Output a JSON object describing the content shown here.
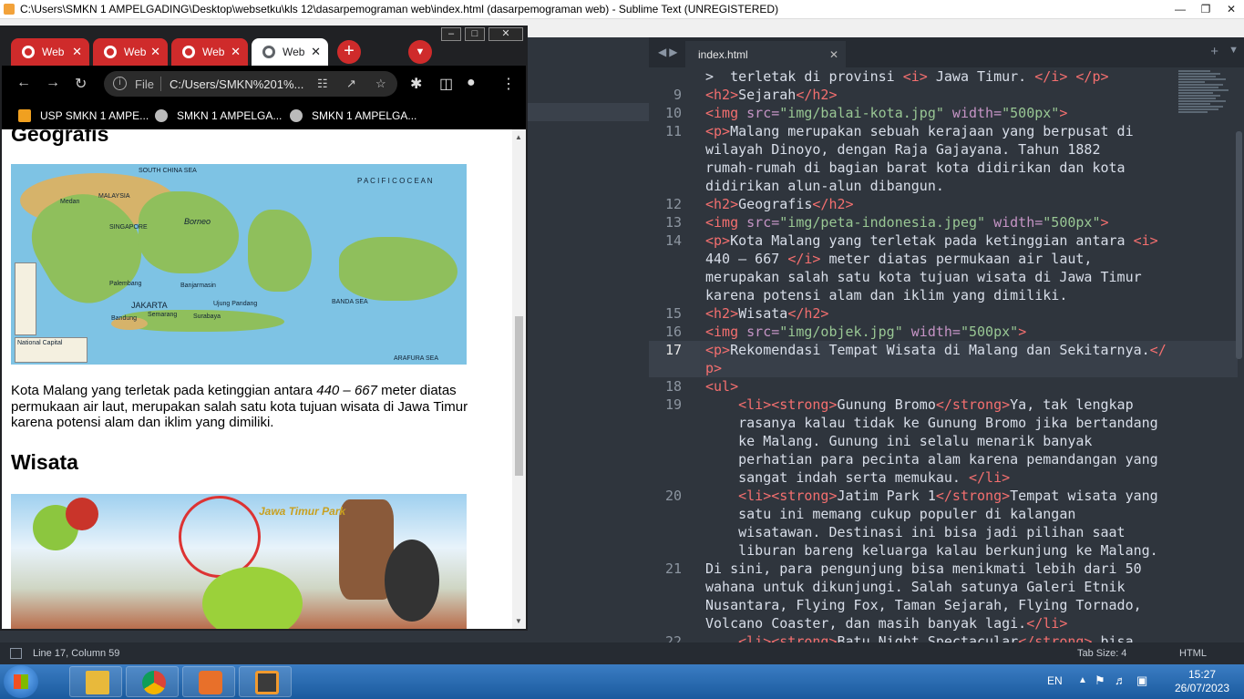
{
  "sublime": {
    "title": "C:\\Users\\SMKN 1 AMPELGADING\\Desktop\\websetku\\kls 12\\dasarpemograman web\\index.html (dasarpemograman web) - Sublime Text (UNREGISTERED)",
    "tab_label": "index.html",
    "status_position": "Line 17, Column 59",
    "status_tab_size": "Tab Size: 4",
    "status_syntax": "HTML"
  },
  "code_lines": [
    {
      "n": "",
      "parts": [
        [
          ">  terletak di provinsi ",
          "w"
        ],
        [
          "<i>",
          "t"
        ],
        [
          " Jawa Timur. ",
          "w"
        ],
        [
          "</i>",
          "t"
        ],
        [
          " ",
          "w"
        ],
        [
          "</p>",
          "t"
        ]
      ]
    },
    {
      "n": "9",
      "parts": [
        [
          "<h2>",
          "t"
        ],
        [
          "Sejarah",
          "w"
        ],
        [
          "</h2>",
          "t"
        ]
      ]
    },
    {
      "n": "10",
      "parts": [
        [
          "<img ",
          "t"
        ],
        [
          "src=",
          "a"
        ],
        [
          "\"img/balai-kota.jpg\"",
          "s"
        ],
        [
          " width=",
          "a"
        ],
        [
          "\"500px\"",
          "s"
        ],
        [
          ">",
          "t"
        ]
      ]
    },
    {
      "n": "11",
      "parts": [
        [
          "<p>",
          "t"
        ],
        [
          "Malang merupakan sebuah kerajaan yang berpusat di",
          "w"
        ]
      ]
    },
    {
      "n": "",
      "parts": [
        [
          "wilayah Dinoyo, dengan Raja Gajayana. Tahun 1882",
          "w"
        ]
      ]
    },
    {
      "n": "",
      "parts": [
        [
          "rumah-rumah di bagian barat kota didirikan dan kota",
          "w"
        ]
      ]
    },
    {
      "n": "",
      "parts": [
        [
          "didirikan alun-alun dibangun.",
          "w"
        ]
      ]
    },
    {
      "n": "12",
      "parts": [
        [
          "<h2>",
          "t"
        ],
        [
          "Geografis",
          "w"
        ],
        [
          "</h2>",
          "t"
        ]
      ]
    },
    {
      "n": "13",
      "parts": [
        [
          "<img ",
          "t"
        ],
        [
          "src=",
          "a"
        ],
        [
          "\"img/peta-indonesia.jpeg\"",
          "s"
        ],
        [
          " width=",
          "a"
        ],
        [
          "\"500px\"",
          "s"
        ],
        [
          ">",
          "t"
        ]
      ]
    },
    {
      "n": "14",
      "parts": [
        [
          "<p>",
          "t"
        ],
        [
          "Kota Malang yang terletak pada ketinggian antara ",
          "w"
        ],
        [
          "<i>",
          "t"
        ]
      ]
    },
    {
      "n": "",
      "parts": [
        [
          "440 – 667 ",
          "w"
        ],
        [
          "</i>",
          "t"
        ],
        [
          " meter diatas permukaan air laut,",
          "w"
        ]
      ]
    },
    {
      "n": "",
      "parts": [
        [
          "merupakan salah satu kota tujuan wisata di Jawa Timur",
          "w"
        ]
      ]
    },
    {
      "n": "",
      "parts": [
        [
          "karena potensi alam dan iklim yang dimiliki.",
          "w"
        ]
      ]
    },
    {
      "n": "15",
      "parts": [
        [
          "<h2>",
          "t"
        ],
        [
          "Wisata",
          "w"
        ],
        [
          "</h2>",
          "t"
        ]
      ]
    },
    {
      "n": "16",
      "parts": [
        [
          "<img ",
          "t"
        ],
        [
          "src=",
          "a"
        ],
        [
          "\"img/objek.jpg\"",
          "s"
        ],
        [
          " width=",
          "a"
        ],
        [
          "\"500px\"",
          "s"
        ],
        [
          ">",
          "t"
        ]
      ]
    },
    {
      "n": "17",
      "cur": true,
      "parts": [
        [
          "<p>",
          "t"
        ],
        [
          "Rekomendasi Tempat Wisata di Malang dan Sekitarnya.",
          "w"
        ],
        [
          "</",
          "t"
        ]
      ]
    },
    {
      "n": "",
      "cur": true,
      "parts": [
        [
          "p>",
          "t"
        ]
      ]
    },
    {
      "n": "18",
      "parts": [
        [
          "<ul>",
          "t"
        ]
      ]
    },
    {
      "n": "19",
      "parts": [
        [
          "    ",
          "w"
        ],
        [
          "<li>",
          "t"
        ],
        [
          "<strong>",
          "t"
        ],
        [
          "Gunung Bromo",
          "w"
        ],
        [
          "</strong>",
          "t"
        ],
        [
          "Ya, tak lengkap",
          "w"
        ]
      ]
    },
    {
      "n": "",
      "parts": [
        [
          "    rasanya kalau tidak ke Gunung Bromo jika bertandang",
          "w"
        ]
      ]
    },
    {
      "n": "",
      "parts": [
        [
          "    ke Malang. Gunung ini selalu menarik banyak",
          "w"
        ]
      ]
    },
    {
      "n": "",
      "parts": [
        [
          "    perhatian para pecinta alam karena pemandangan yang",
          "w"
        ]
      ]
    },
    {
      "n": "",
      "parts": [
        [
          "    sangat indah serta memukau. ",
          "w"
        ],
        [
          "</li>",
          "t"
        ]
      ]
    },
    {
      "n": "20",
      "parts": [
        [
          "    ",
          "w"
        ],
        [
          "<li>",
          "t"
        ],
        [
          "<strong>",
          "t"
        ],
        [
          "Jatim Park 1",
          "w"
        ],
        [
          "</strong>",
          "t"
        ],
        [
          "Tempat wisata yang",
          "w"
        ]
      ]
    },
    {
      "n": "",
      "parts": [
        [
          "    satu ini memang cukup populer di kalangan",
          "w"
        ]
      ]
    },
    {
      "n": "",
      "parts": [
        [
          "    wisatawan. Destinasi ini bisa jadi pilihan saat",
          "w"
        ]
      ]
    },
    {
      "n": "",
      "parts": [
        [
          "    liburan bareng keluarga kalau berkunjung ke Malang.",
          "w"
        ]
      ]
    },
    {
      "n": "21",
      "parts": [
        [
          "Di sini, para pengunjung bisa menikmati lebih dari 50",
          "w"
        ]
      ]
    },
    {
      "n": "",
      "parts": [
        [
          "wahana untuk dikunjungi. Salah satunya Galeri Etnik",
          "w"
        ]
      ]
    },
    {
      "n": "",
      "parts": [
        [
          "Nusantara, Flying Fox, Taman Sejarah, Flying Tornado,",
          "w"
        ]
      ]
    },
    {
      "n": "",
      "parts": [
        [
          "Volcano Coaster, dan masih banyak lagi.",
          "w"
        ],
        [
          "</li>",
          "t"
        ]
      ]
    },
    {
      "n": "22",
      "parts": [
        [
          "    ",
          "w"
        ],
        [
          "<li>",
          "t"
        ],
        [
          "<strong>",
          "t"
        ],
        [
          "Batu Night Spectacular",
          "w"
        ],
        [
          "</strong>",
          "t"
        ],
        [
          " bisa",
          "w"
        ]
      ]
    }
  ],
  "colors": {
    "tag": "#f46f6f",
    "attr": "#c594c5",
    "string": "#99c794",
    "text": "#d8dee9"
  },
  "chrome": {
    "tabs": [
      {
        "label": "Web",
        "active": false
      },
      {
        "label": "Web",
        "active": false
      },
      {
        "label": "Web",
        "active": false
      },
      {
        "label": "Web",
        "active": true
      }
    ],
    "address_file": "File",
    "address_url": "C:/Users/SMKN%201%...",
    "bookmarks": [
      "USP SMKN 1 AMPE...",
      "SMKN 1 AMPELGA...",
      "SMKN 1 AMPELGA..."
    ]
  },
  "webpage": {
    "heading_geografis": "Geografis",
    "map_labels": {
      "south_china_sea": "SOUTH CHINA SEA",
      "pacific_ocean": "P A C I F I C   O C E A N",
      "malaysia": "MALAYSIA",
      "medan": "Medan",
      "singapore": "SINGAPORE",
      "borneo": "Borneo",
      "palembang": "Palembang",
      "jakarta": "JAKARTA",
      "bandung": "Bandung",
      "semarang": "Semarang",
      "surabaya": "Surabaya",
      "ujung_pandang": "Ujung Pandang",
      "banjarmasin": "Banjarmasin",
      "banda_sea": "BANDA SEA",
      "arafura_sea": "ARAFURA SEA",
      "legend": "National Capital"
    },
    "para_geo_pre": "Kota Malang yang terletak pada ketinggian antara ",
    "para_geo_em": "440 – 667",
    "para_geo_post": " meter diatas permukaan air laut, merupakan salah satu kota tujuan wisata di Jawa Timur karena potensi alam dan iklim yang dimiliki.",
    "heading_wisata": "Wisata",
    "wisata_sign": "Jawa Timur Park"
  },
  "taskbar": {
    "lang": "EN",
    "time": "15:27",
    "date": "26/07/2023"
  }
}
